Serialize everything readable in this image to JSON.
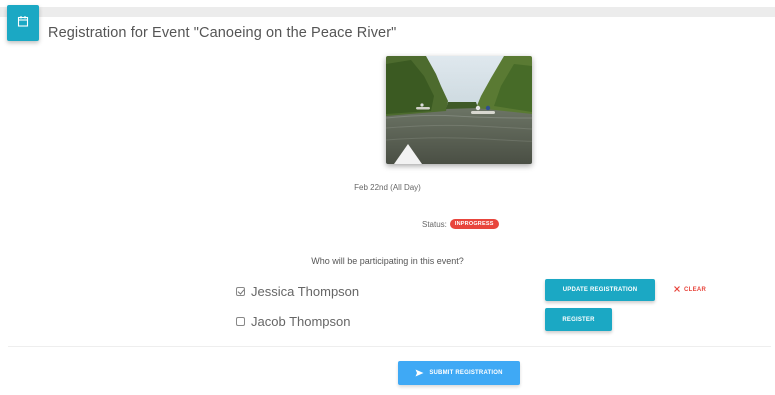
{
  "header": {
    "title": "Registration for Event \"Canoeing on the Peace River\"",
    "icon": "calendar-icon",
    "accent_color": "#1ba8c4"
  },
  "event": {
    "image": "canoe-river-photo",
    "date": "Feb 22nd (All Day)",
    "status_label": "Status:",
    "status_value": "INPROGRESS",
    "status_color": "#e8453c"
  },
  "registration": {
    "question": "Who will be participating in this event?",
    "participants": [
      {
        "name": "Jessica Thompson",
        "checked": true,
        "action_label": "UPDATE REGISTRATION",
        "secondary_label": "CLEAR"
      },
      {
        "name": "Jacob Thompson",
        "checked": false,
        "action_label": "REGISTER"
      }
    ],
    "submit_label": "SUBMIT REGISTRATION",
    "submit_color": "#3fa9f5"
  }
}
